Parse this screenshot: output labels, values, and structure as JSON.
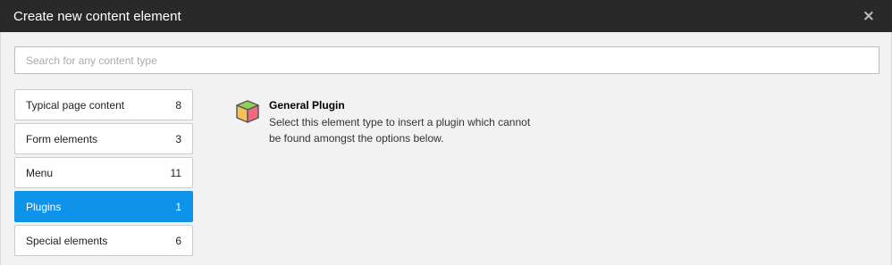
{
  "header": {
    "title": "Create new content element",
    "close_symbol": "×"
  },
  "search": {
    "value": "",
    "placeholder": "Search for any content type"
  },
  "categories": [
    {
      "label": "Typical page content",
      "count": "8",
      "active": false
    },
    {
      "label": "Form elements",
      "count": "3",
      "active": false
    },
    {
      "label": "Menu",
      "count": "11",
      "active": false
    },
    {
      "label": "Plugins",
      "count": "1",
      "active": true
    },
    {
      "label": "Special elements",
      "count": "6",
      "active": false
    }
  ],
  "content": {
    "items": [
      {
        "title": "General Plugin",
        "description_line1": "Select this element type to insert a plugin which cannot",
        "description_line2": "be found amongst the options below.",
        "icon": "cube-icon"
      }
    ]
  },
  "colors": {
    "header_bg": "#292929",
    "active_accent": "#0d93e7",
    "body_bg": "#f2f2f2"
  }
}
